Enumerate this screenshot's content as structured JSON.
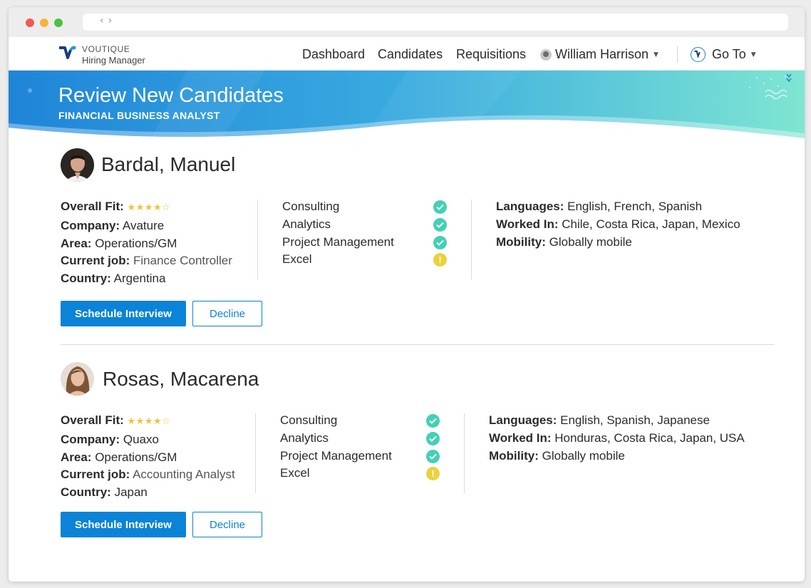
{
  "app": {
    "brand_top": "VOUTIQUE",
    "brand_bottom": "Hiring Manager",
    "nav": [
      "Dashboard",
      "Candidates",
      "Requisitions"
    ],
    "user": "William Harrison",
    "goto": "Go To"
  },
  "banner": {
    "title": "Review New Candidates",
    "subtitle": "FINANCIAL BUSINESS ANALYST"
  },
  "labels": {
    "overall_fit": "Overall Fit:",
    "company": "Company:",
    "area": "Area:",
    "current_job": "Current job:",
    "country": "Country:",
    "languages": "Languages:",
    "worked_in": "Worked In:",
    "mobility": "Mobility:",
    "schedule": "Schedule Interview",
    "decline": "Decline"
  },
  "candidates": [
    {
      "name": "Bardal, Manuel",
      "rating": 4,
      "rating_stars": "★★★★☆",
      "company": "Avature",
      "area": "Operations/GM",
      "current_job": "Finance Controller",
      "country": "Argentina",
      "skills": [
        {
          "label": "Consulting",
          "status": "check-icon"
        },
        {
          "label": "Analytics",
          "status": "check-icon"
        },
        {
          "label": "Project Management",
          "status": "check-icon"
        },
        {
          "label": "Excel",
          "status": "warning-icon"
        }
      ],
      "languages": "English, French, Spanish",
      "worked_in": "Chile, Costa Rica, Japan, Mexico",
      "mobility": "Globally mobile"
    },
    {
      "name": "Rosas, Macarena",
      "rating": 4,
      "rating_stars": "★★★★☆",
      "company": "Quaxo",
      "area": "Operations/GM",
      "current_job": "Accounting Analyst",
      "country": "Japan",
      "skills": [
        {
          "label": "Consulting",
          "status": "check-icon"
        },
        {
          "label": "Analytics",
          "status": "check-icon"
        },
        {
          "label": "Project Management",
          "status": "check-icon"
        },
        {
          "label": "Excel",
          "status": "warning-icon"
        }
      ],
      "languages": "English, Spanish, Japanese",
      "worked_in": "Honduras, Costa Rica, Japan, USA",
      "mobility": "Globally mobile"
    }
  ],
  "colors": {
    "primary": "#0b83d6",
    "check": "#42d1b4",
    "warning": "#ebd23d",
    "star": "#f0c23c"
  }
}
